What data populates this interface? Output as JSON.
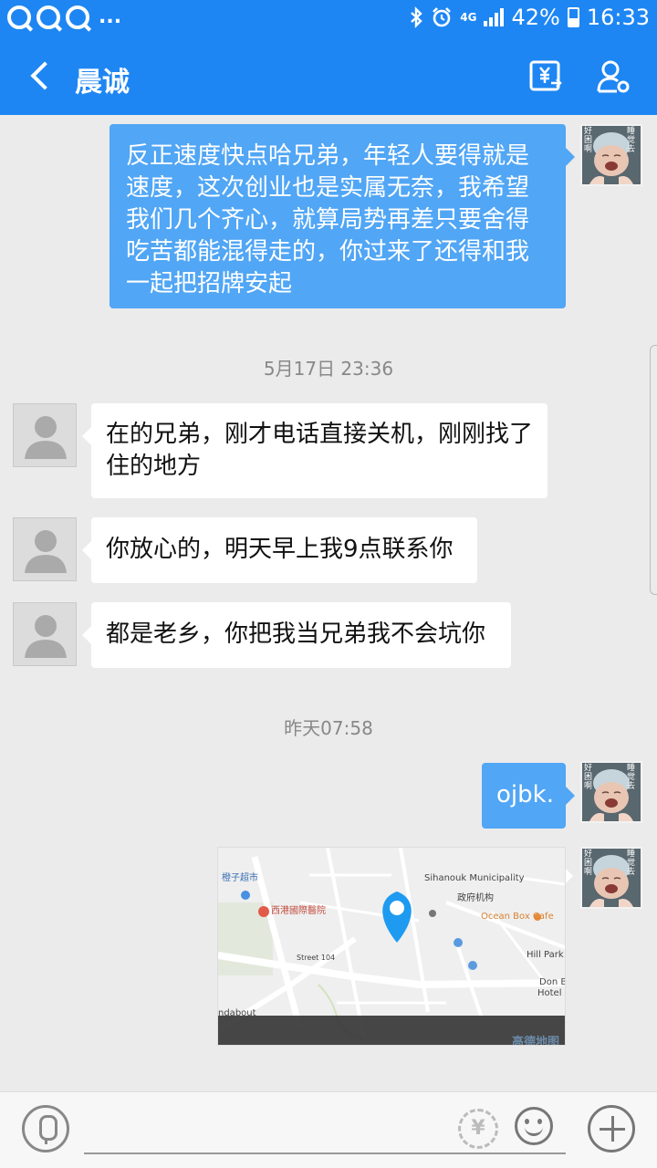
{
  "status_bar": {
    "app_dots": "...",
    "network": "4G",
    "battery": "42%",
    "time": "16:33"
  },
  "header": {
    "title": "晨诚"
  },
  "messages": [
    {
      "side": "out",
      "text": "反正速度快点哈兄弟，年轻人要得就是速度，这次创业也是实属无奈，我希望我们几个齐心，就算局势再差只要舍得吃苦都能混得走的，你过来了还得和我一起把招牌安起"
    },
    {
      "timestamp": "5月17日 23:36"
    },
    {
      "side": "in",
      "text": "在的兄弟，刚才电话直接关机，刚刚找了住的地方"
    },
    {
      "side": "in",
      "text": "你放心的，明天早上我9点联系你"
    },
    {
      "side": "in",
      "text": "都是老乡，你把我当兄弟我不会坑你"
    },
    {
      "timestamp": "昨天07:58"
    },
    {
      "side": "out",
      "text": "ojbk."
    },
    {
      "side": "out",
      "type": "location"
    }
  ],
  "avatar_self": {
    "caption_left": "好困啊",
    "caption_right": "睡觉去"
  },
  "map": {
    "labels": [
      "橙子超市",
      "西港國際醫院",
      "Sihanouk Municipality",
      "政府机构",
      "Ocean Box Cafe",
      "Hill Park V",
      "Don B",
      "Hotel S",
      "ndabout",
      "Street 104",
      "高德地图"
    ]
  },
  "colors": {
    "brand": "#1e86f3",
    "outgoing_bubble": "#51a6f5",
    "incoming_bubble": "#ffffff",
    "background": "#ebebeb",
    "map_pin": "#1e9bf0"
  }
}
